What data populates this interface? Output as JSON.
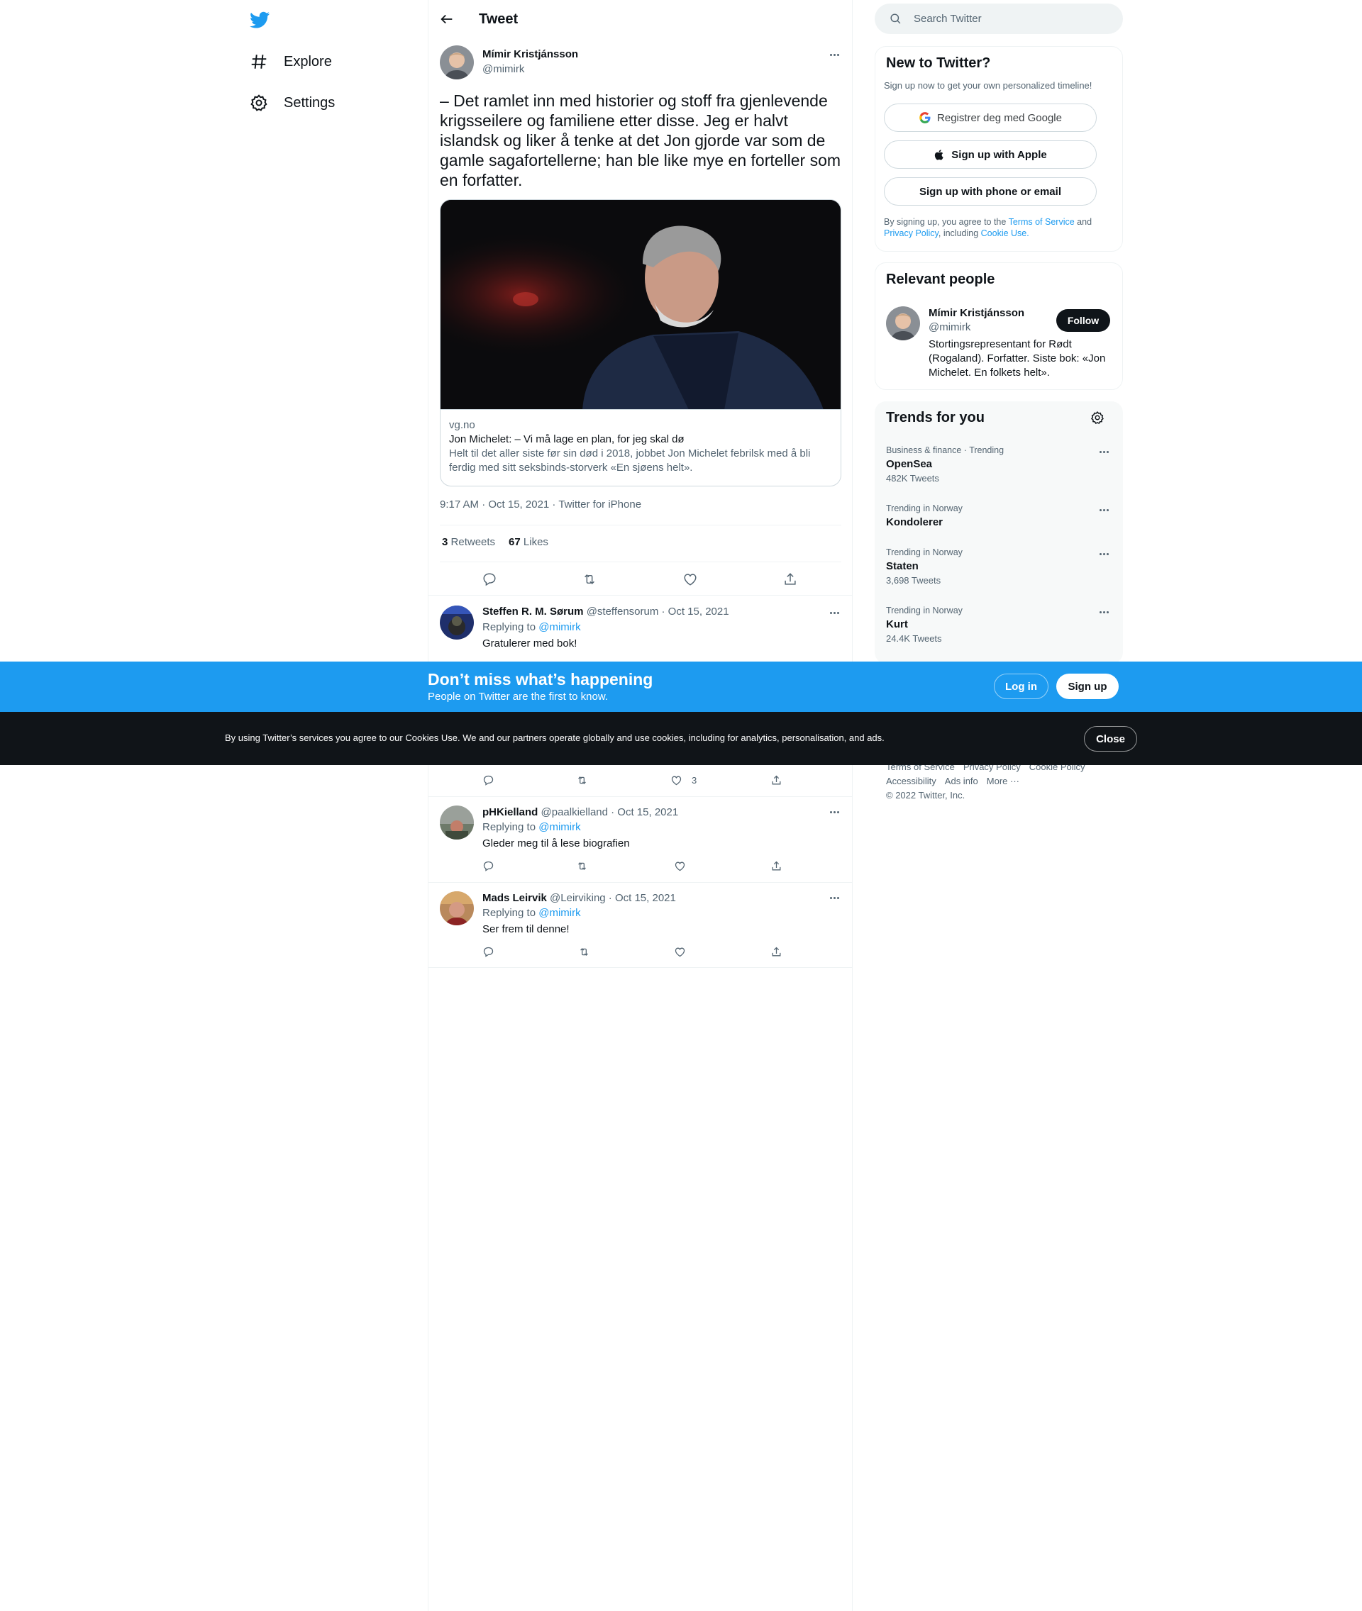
{
  "nav": {
    "items": [
      {
        "label": "Explore",
        "icon": "hashtag-icon"
      },
      {
        "label": "Settings",
        "icon": "gear-icon"
      }
    ]
  },
  "header": {
    "title": "Tweet"
  },
  "tweet": {
    "author_name": "Mímir Kristjánsson",
    "author_handle": "@mimirk",
    "text": "– Det ramlet inn med historier og stoff fra gjenlevende krigsseilere og familiene etter disse. Jeg er halvt islandsk og liker å tenke at det Jon gjorde var som de gamle sagafortellerne; han ble like mye en forteller som en forfatter.",
    "card": {
      "domain": "vg.no",
      "title": "Jon Michelet: – Vi må lage en plan, for jeg skal dø",
      "description": "Helt til det aller siste før sin død i 2018, jobbet Jon Michelet febrilsk med å bli ferdig med sitt seksbinds-storverk «En sjøens helt»."
    },
    "meta": "9:17 AM · Oct 15, 2021 · Twitter for iPhone",
    "retweets_count": "3",
    "retweets_label": "Retweets",
    "likes_count": "67",
    "likes_label": "Likes"
  },
  "replies": [
    {
      "name": "Steffen R. M. Sørum",
      "handle_date": "@steffensorum · Oct 15, 2021",
      "replying_prefix": "Replying to ",
      "replying_to": "@mimirk",
      "text": "Gratulerer med bok!",
      "like_count": "3"
    },
    {
      "name": "pHKielland",
      "handle_date": "@paalkielland · Oct 15, 2021",
      "replying_prefix": "Replying to ",
      "replying_to": "@mimirk",
      "text": "Gleder meg til å lese biografien"
    },
    {
      "name": "Mads Leirvik",
      "handle_date": "@Leirviking · Oct 15, 2021",
      "replying_prefix": "Replying to ",
      "replying_to": "@mimirk",
      "text": "Ser frem til denne!"
    }
  ],
  "search": {
    "placeholder": "Search Twitter"
  },
  "new_to_twitter": {
    "title": "New to Twitter?",
    "subtitle": "Sign up now to get your own personalized timeline!",
    "google_label": "Registrer deg med Google",
    "apple_label": "Sign up with Apple",
    "phone_label": "Sign up with phone or email",
    "legal_prefix": "By signing up, you agree to the ",
    "terms": "Terms of Service",
    "and": " and",
    "privacy": "Privacy Policy",
    "including": ", including ",
    "cookie": "Cookie Use."
  },
  "relevant_people": {
    "title": "Relevant people",
    "name": "Mímir Kristjánsson",
    "handle": "@mimirk",
    "follow_label": "Follow",
    "bio": "Stortingsrepresentant for Rødt (Rogaland). Forfatter. Siste bok: «Jon Michelet. En folkets helt»."
  },
  "trends": {
    "title": "Trends for you",
    "items": [
      {
        "context": "Business & finance · Trending",
        "name": "OpenSea",
        "count": "482K Tweets"
      },
      {
        "context": "Trending in Norway",
        "name": "Kondolerer",
        "count": ""
      },
      {
        "context": "Trending in Norway",
        "name": "Staten",
        "count": "3,698 Tweets"
      },
      {
        "context": "Trending in Norway",
        "name": "Kurt",
        "count": "24.4K Tweets"
      }
    ]
  },
  "footer": {
    "row1": [
      "Terms of Service",
      "Privacy Policy",
      "Cookie Policy"
    ],
    "row2": [
      "Accessibility",
      "Ads info",
      "More ···"
    ],
    "copyright": "© 2022 Twitter, Inc."
  },
  "signup_banner": {
    "title": "Don’t miss what’s happening",
    "subtitle": "People on Twitter are the first to know.",
    "login_label": "Log in",
    "signup_label": "Sign up"
  },
  "cookie_banner": {
    "text": "By using Twitter’s services you agree to our Cookies Use. We and our partners operate globally and use cookies, including for analytics, personalisation, and ads.",
    "close_label": "Close"
  },
  "colors": {
    "accent": "#1d9bf0",
    "text": "#0f1419",
    "muted": "#536471",
    "banner_dark": "#101418"
  }
}
